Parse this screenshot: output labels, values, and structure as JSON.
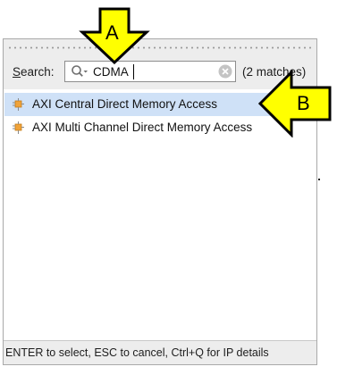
{
  "search": {
    "label": "Search:",
    "label_mnemonic": "S",
    "label_rest": "earch:",
    "value": "CDMA",
    "match_count": "(2 matches)",
    "icon": "search-icon"
  },
  "results": [
    {
      "label": "AXI Central Direct Memory Access",
      "selected": true,
      "icon": "ip-core-icon"
    },
    {
      "label": "AXI Multi Channel Direct Memory Access",
      "selected": false,
      "icon": "ip-core-icon"
    }
  ],
  "status_bar": {
    "text": "ENTER to select, ESC to cancel, Ctrl+Q for IP details"
  },
  "callouts": [
    {
      "letter": "A",
      "target": "search-input"
    },
    {
      "letter": "B",
      "target": "result-item-1"
    }
  ],
  "colors": {
    "callout_fill": "#ffff00",
    "selection": "#cfe1f7",
    "panel_background": "#ededed"
  }
}
